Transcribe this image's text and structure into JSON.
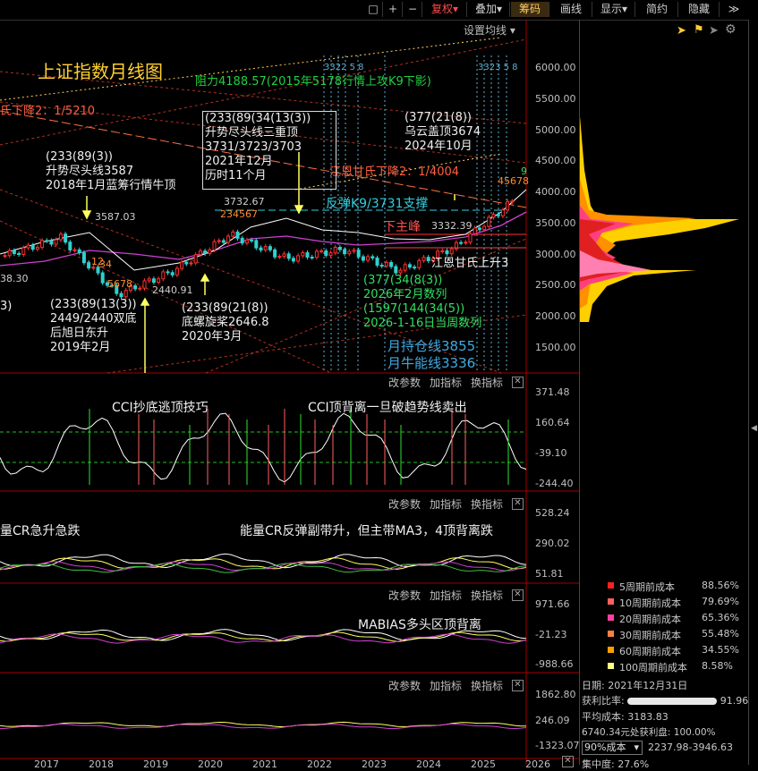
{
  "toolbar": {
    "buttons": [
      "复权",
      "叠加",
      "筹码",
      "画线",
      "显示",
      "简约",
      "隐藏"
    ],
    "ff_label": "≫",
    "icons": [
      "square-icon",
      "plus-icon",
      "minus-icon"
    ]
  },
  "main": {
    "settings_label": "设置均线",
    "title": "上证指数月线图",
    "y_ticks": [
      "6000.00",
      "5500.00",
      "5000.00",
      "4500.00",
      "4000.00",
      "3500.00",
      "3000.00",
      "2500.00",
      "2000.00",
      "1500.00"
    ],
    "annotations": {
      "resistance": "阻力4188.57(2015年5178行情上攻K9下影)",
      "gann_down1": "氏下降2：1/5210",
      "gann_down2": "江恩甘氏下降2：1/4004",
      "head3_title": "(233(89(34(13(3))",
      "head3_l1": "升势尽头线三重顶",
      "head3_l2": "3731/3723/3703",
      "head3_l3": "2021年12月",
      "head3_l4": "历时11个月",
      "cloud_title": "(377(21(8))",
      "cloud_l1": "乌云盖顶3674",
      "cloud_l2": "2024年10月",
      "top2018_title": "(233(89(3))",
      "top2018_l1": "升势尽头线3587",
      "top2018_l2": "2018年1月蓝筹行情牛顶",
      "rebound": "反弹K9/3731支撑",
      "lower_peak": "下主峰",
      "gann_up": "江恩甘氏上升3",
      "double_title": "(233(89(13(3))",
      "double_l1": "2449/2440双底",
      "double_l2": "后旭日东升",
      "double_l3": "2019年2月",
      "spiral_title": "(233(89(21(8))",
      "spiral_l1": "底螺旋桨2646.8",
      "spiral_l2": "2020年3月",
      "series_title": "(377(34(8(3))",
      "series_l1": "2026年2月数列",
      "series_l2": "(1597(144(34(5))",
      "series_l3": "2026-1-16日当周数列",
      "month_hold": "月持仓线3855",
      "month_bull": "月牛能线3336",
      "left_val": "38.30",
      "left_3": "3)",
      "price_3587": "3587.03",
      "price_3732": "3732.67",
      "price_2440": "2440.91",
      "price_3332": "3332.39",
      "seq_12": "12",
      "seq_34": "34",
      "seq_5678": "5678",
      "seq_234567": "234567",
      "seq_9": "9",
      "seq_top": "45678",
      "label_3322": "3322 5 8",
      "label_3323": "3323 5 8"
    }
  },
  "cci": {
    "tools": [
      "改参数",
      "加指标",
      "换指标"
    ],
    "y_ticks": [
      "371.48",
      "160.64",
      "-39.10",
      "-244.40"
    ],
    "note1": "CCI抄底逃顶技巧",
    "note2": "CCI顶背离一旦破趋势线卖出"
  },
  "cr": {
    "tools": [
      "改参数",
      "加指标",
      "换指标"
    ],
    "y_ticks": [
      "528.24",
      "290.02",
      "51.81"
    ],
    "note1": "量CR急升急跌",
    "note2": "能量CR反弹副带升，但主带MA3，4顶背离跌"
  },
  "mabias": {
    "tools": [
      "改参数",
      "加指标",
      "换指标"
    ],
    "y_ticks": [
      "971.66",
      "-21.23",
      "-988.66"
    ],
    "note": "MABIAS多头区顶背离"
  },
  "vol": {
    "tools": [
      "改参数",
      "加指标",
      "换指标"
    ],
    "y_ticks": [
      "1862.80",
      "246.09",
      "-1323.07"
    ]
  },
  "x_axis": [
    "2017",
    "2018",
    "2019",
    "2020",
    "2021",
    "2022",
    "2023",
    "2024",
    "2025",
    "2026"
  ],
  "right_panel": {
    "legend": [
      {
        "label": "5周期前成本",
        "value": "88.56%",
        "color": "#ff2020"
      },
      {
        "label": "10周期前成本",
        "value": "79.69%",
        "color": "#ff6060"
      },
      {
        "label": "20周期前成本",
        "value": "65.36%",
        "color": "#ff40a0"
      },
      {
        "label": "30周期前成本",
        "value": "55.48%",
        "color": "#ff8040"
      },
      {
        "label": "60周期前成本",
        "value": "34.55%",
        "color": "#ffa000"
      },
      {
        "label": "100周期前成本",
        "value": "8.58%",
        "color": "#ffff80"
      }
    ],
    "date_label": "日期:",
    "date_value": "2021年12月31日",
    "profit_ratio_label": "获利比率:",
    "profit_ratio_value": "91.96%",
    "avg_cost_label": "平均成本:",
    "avg_cost_value": "3183.83",
    "profit_line": "6740.34元处获利盘: 100.00%",
    "cost_select": "90%成本",
    "cost_range": "2237.98-3946.63",
    "concentration": "集中度: 27.6%",
    "chips_icons": [
      "pointer-icon",
      "flag-icon",
      "pointer-gray-icon",
      "gear-icon"
    ]
  },
  "chart_data": {
    "type": "line",
    "title": "上证指数月线图",
    "x": [
      "2017",
      "2018",
      "2019",
      "2020",
      "2021",
      "2022",
      "2023",
      "2024",
      "2025",
      "2026"
    ],
    "ylim": [
      1200,
      6400
    ],
    "series": [
      {
        "values": [
          3150,
          3450,
          2500,
          2900,
          3500,
          3100,
          3250,
          2900,
          3300,
          4050
        ]
      }
    ]
  }
}
